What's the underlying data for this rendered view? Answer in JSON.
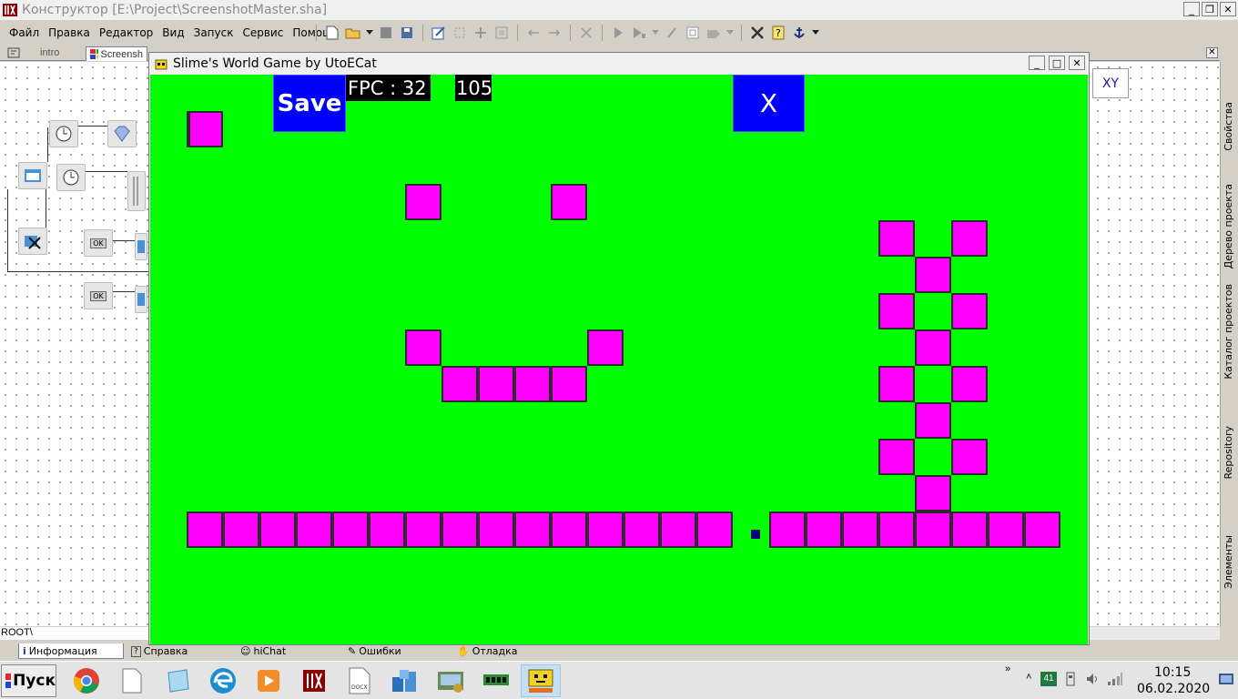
{
  "app": {
    "title": "Конструктор [E:\\Project\\ScreenshotMaster.sha]",
    "window_buttons": [
      "_",
      "❐",
      "✕"
    ]
  },
  "menu": [
    "Файл",
    "Правка",
    "Редактор",
    "Вид",
    "Запуск",
    "Сервис",
    "Помощь"
  ],
  "tabs": [
    "intro",
    "Screensh"
  ],
  "canvas": {
    "xy_label": "XY",
    "button_label": "OK",
    "path": "ROOT\\"
  },
  "side_panel": [
    "Свойства",
    "Дерево проекта",
    "Каталог проектов",
    "Repository",
    "Элементы"
  ],
  "bottom_tabs": [
    "Информация",
    "Справка",
    "hiChat",
    "Ошибки",
    "Отладка"
  ],
  "game": {
    "title": "Slime's World Game by UtoECat",
    "save_label": "Save",
    "close_label": "X",
    "fpc_label": "FPC : 32",
    "counter": "105",
    "window_buttons": [
      "_",
      "□",
      "✕"
    ],
    "colors": {
      "background": "#00ff00",
      "block": "#ff00ff",
      "button": "#0000ff",
      "player": "#000080"
    }
  },
  "taskbar": {
    "start_label": "Пуск",
    "apps": [
      "chrome-icon",
      "file-icon",
      "notepad-icon",
      "edge-icon",
      "media-player-icon",
      "hiasm-icon",
      "docx-icon",
      "installer-icon",
      "control-panel-icon",
      "ram-icon",
      "slime-game-icon"
    ],
    "tray_badge": "41",
    "clock_time": "10:15",
    "clock_date": "06.02.2020"
  }
}
